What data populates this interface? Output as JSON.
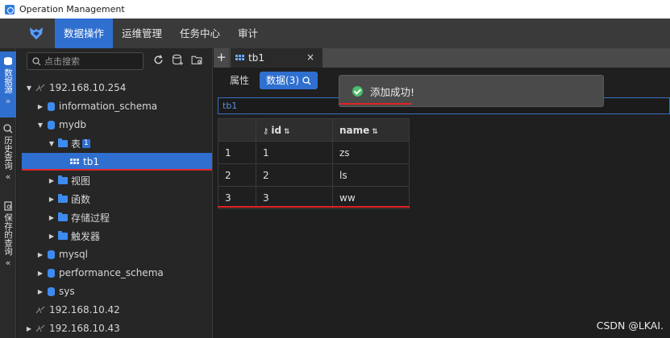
{
  "window": {
    "title": "Operation Management"
  },
  "nav": {
    "items": [
      {
        "label": "数据操作",
        "active": true
      },
      {
        "label": "运维管理",
        "active": false
      },
      {
        "label": "任务中心",
        "active": false
      },
      {
        "label": "审计",
        "active": false
      }
    ]
  },
  "rail": {
    "sections": [
      {
        "label": "数据源",
        "active": true,
        "chevron": "»"
      },
      {
        "label": "历史查询",
        "active": false,
        "chevron": "«"
      },
      {
        "label": "保存的查询",
        "active": false,
        "chevron": "«"
      }
    ]
  },
  "sidebar": {
    "search_placeholder": "点击搜索",
    "tree": {
      "host1": "192.168.10.254",
      "db_information_schema": "information_schema",
      "db_mydb": "mydb",
      "folder_tables": "表",
      "tables_count": "1",
      "table_tb1": "tb1",
      "folder_views": "视图",
      "folder_functions": "函数",
      "folder_procedures": "存储过程",
      "folder_triggers": "触发器",
      "db_mysql": "mysql",
      "db_performance_schema": "performance_schema",
      "db_sys": "sys",
      "host2": "192.168.10.42",
      "host3": "192.168.10.43"
    }
  },
  "editor": {
    "tab_title": "tb1",
    "tab_add": "+",
    "tab_close": "×",
    "subtab_properties": "属性",
    "subtab_data": "数据(3)",
    "filter_value": "tb1",
    "columns": {
      "index": "",
      "id": "id",
      "name": "name"
    },
    "rows": [
      {
        "index": "1",
        "id": "1",
        "name": "zs"
      },
      {
        "index": "2",
        "id": "2",
        "name": "ls"
      },
      {
        "index": "3",
        "id": "3",
        "name": "ww"
      }
    ]
  },
  "toast": {
    "message": "添加成功!"
  },
  "watermark": "CSDN @LKAI.",
  "colors": {
    "accent": "#2f6fcf",
    "highlight": "#e02323",
    "success": "#4bbf6b"
  }
}
